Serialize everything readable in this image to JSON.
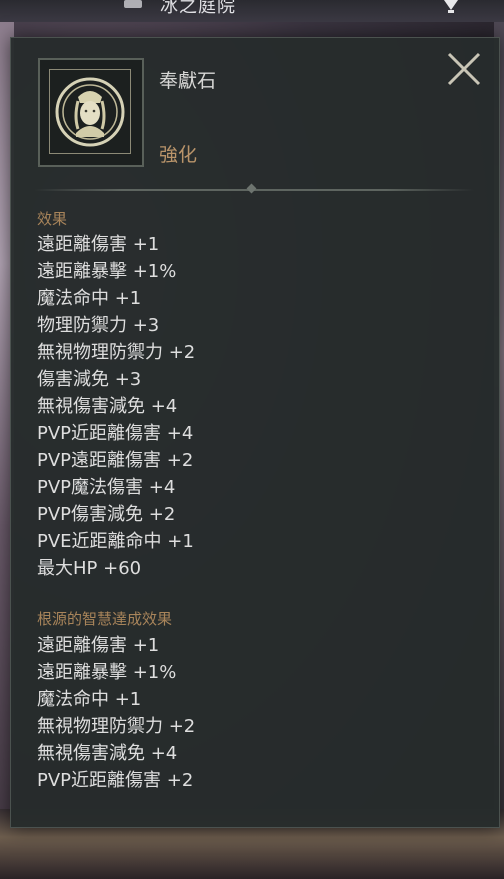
{
  "background": {
    "top_title": "冰之庭院",
    "top_icon": "square-icon",
    "top_pin_icon": "map-pin-icon"
  },
  "tooltip": {
    "item_name": "奉獻石",
    "item_type": "強化",
    "item_icon": "goddess-portrait-icon",
    "close_icon": "close-icon",
    "effects_title": "效果",
    "effects": [
      "遠距離傷害 +1",
      "遠距離暴擊 +1%",
      "魔法命中 +1",
      "物理防禦力 +3",
      "無視物理防禦力 +2",
      "傷害減免 +3",
      "無視傷害減免 +4",
      "PVP近距離傷害 +4",
      "PVP遠距離傷害 +2",
      "PVP魔法傷害 +4",
      "PVP傷害減免 +2",
      "PVE近距離命中 +1",
      "最大HP +60"
    ],
    "bonus_title": "根源的智慧達成效果",
    "bonus_effects": [
      "遠距離傷害 +1",
      "遠距離暴擊 +1%",
      "魔法命中 +1",
      "無視物理防禦力 +2",
      "無視傷害減免 +4",
      "PVP近距離傷害 +2"
    ]
  },
  "colors": {
    "panel_bg": "#262c2c",
    "section_title": "#a8845a",
    "item_type": "#b9946a",
    "text": "#dedede"
  }
}
